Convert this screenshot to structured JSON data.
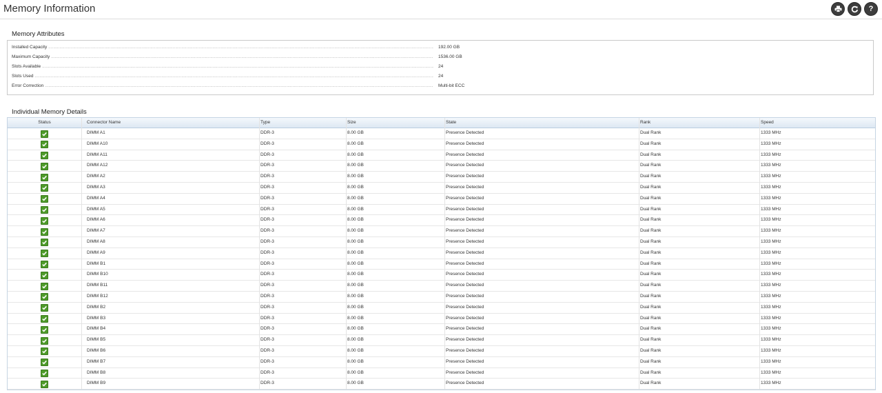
{
  "header": {
    "title": "Memory Information"
  },
  "toolbar": {
    "print_icon": "printer-icon",
    "refresh_icon": "refresh-icon",
    "help_icon": "help-icon",
    "help_glyph": "?"
  },
  "attributes": {
    "title": "Memory Attributes",
    "rows": [
      {
        "label": "Installed Capacity",
        "value": "192.00 GB"
      },
      {
        "label": "Maximum Capacity",
        "value": "1536.00 GB"
      },
      {
        "label": "Slots Available",
        "value": "24"
      },
      {
        "label": "Slots Used",
        "value": "24"
      },
      {
        "label": "Error Correction",
        "value": "Multi-bit ECC"
      }
    ]
  },
  "details": {
    "title": "Individual Memory Details",
    "columns": {
      "status": "Status",
      "name": "Connector Name",
      "type": "Type",
      "size": "Size",
      "state": "State",
      "rank": "Rank",
      "speed": "Speed"
    },
    "status_color": "#4e9a2a",
    "rows": [
      {
        "name": "DIMM A1",
        "type": "DDR-3",
        "size": "8.00 GB",
        "state": "Presence Detected",
        "rank": "Dual Rank",
        "speed": "1333 MHz"
      },
      {
        "name": "DIMM A10",
        "type": "DDR-3",
        "size": "8.00 GB",
        "state": "Presence Detected",
        "rank": "Dual Rank",
        "speed": "1333 MHz"
      },
      {
        "name": "DIMM A11",
        "type": "DDR-3",
        "size": "8.00 GB",
        "state": "Presence Detected",
        "rank": "Dual Rank",
        "speed": "1333 MHz"
      },
      {
        "name": "DIMM A12",
        "type": "DDR-3",
        "size": "8.00 GB",
        "state": "Presence Detected",
        "rank": "Dual Rank",
        "speed": "1333 MHz"
      },
      {
        "name": "DIMM A2",
        "type": "DDR-3",
        "size": "8.00 GB",
        "state": "Presence Detected",
        "rank": "Dual Rank",
        "speed": "1333 MHz"
      },
      {
        "name": "DIMM A3",
        "type": "DDR-3",
        "size": "8.00 GB",
        "state": "Presence Detected",
        "rank": "Dual Rank",
        "speed": "1333 MHz"
      },
      {
        "name": "DIMM A4",
        "type": "DDR-3",
        "size": "8.00 GB",
        "state": "Presence Detected",
        "rank": "Dual Rank",
        "speed": "1333 MHz"
      },
      {
        "name": "DIMM A5",
        "type": "DDR-3",
        "size": "8.00 GB",
        "state": "Presence Detected",
        "rank": "Dual Rank",
        "speed": "1333 MHz"
      },
      {
        "name": "DIMM A6",
        "type": "DDR-3",
        "size": "8.00 GB",
        "state": "Presence Detected",
        "rank": "Dual Rank",
        "speed": "1333 MHz"
      },
      {
        "name": "DIMM A7",
        "type": "DDR-3",
        "size": "8.00 GB",
        "state": "Presence Detected",
        "rank": "Dual Rank",
        "speed": "1333 MHz"
      },
      {
        "name": "DIMM A8",
        "type": "DDR-3",
        "size": "8.00 GB",
        "state": "Presence Detected",
        "rank": "Dual Rank",
        "speed": "1333 MHz"
      },
      {
        "name": "DIMM A9",
        "type": "DDR-3",
        "size": "8.00 GB",
        "state": "Presence Detected",
        "rank": "Dual Rank",
        "speed": "1333 MHz"
      },
      {
        "name": "DIMM B1",
        "type": "DDR-3",
        "size": "8.00 GB",
        "state": "Presence Detected",
        "rank": "Dual Rank",
        "speed": "1333 MHz"
      },
      {
        "name": "DIMM B10",
        "type": "DDR-3",
        "size": "8.00 GB",
        "state": "Presence Detected",
        "rank": "Dual Rank",
        "speed": "1333 MHz"
      },
      {
        "name": "DIMM B11",
        "type": "DDR-3",
        "size": "8.00 GB",
        "state": "Presence Detected",
        "rank": "Dual Rank",
        "speed": "1333 MHz"
      },
      {
        "name": "DIMM B12",
        "type": "DDR-3",
        "size": "8.00 GB",
        "state": "Presence Detected",
        "rank": "Dual Rank",
        "speed": "1333 MHz"
      },
      {
        "name": "DIMM B2",
        "type": "DDR-3",
        "size": "8.00 GB",
        "state": "Presence Detected",
        "rank": "Dual Rank",
        "speed": "1333 MHz"
      },
      {
        "name": "DIMM B3",
        "type": "DDR-3",
        "size": "8.00 GB",
        "state": "Presence Detected",
        "rank": "Dual Rank",
        "speed": "1333 MHz"
      },
      {
        "name": "DIMM B4",
        "type": "DDR-3",
        "size": "8.00 GB",
        "state": "Presence Detected",
        "rank": "Dual Rank",
        "speed": "1333 MHz"
      },
      {
        "name": "DIMM B5",
        "type": "DDR-3",
        "size": "8.00 GB",
        "state": "Presence Detected",
        "rank": "Dual Rank",
        "speed": "1333 MHz"
      },
      {
        "name": "DIMM B6",
        "type": "DDR-3",
        "size": "8.00 GB",
        "state": "Presence Detected",
        "rank": "Dual Rank",
        "speed": "1333 MHz"
      },
      {
        "name": "DIMM B7",
        "type": "DDR-3",
        "size": "8.00 GB",
        "state": "Presence Detected",
        "rank": "Dual Rank",
        "speed": "1333 MHz"
      },
      {
        "name": "DIMM B8",
        "type": "DDR-3",
        "size": "8.00 GB",
        "state": "Presence Detected",
        "rank": "Dual Rank",
        "speed": "1333 MHz"
      },
      {
        "name": "DIMM B9",
        "type": "DDR-3",
        "size": "8.00 GB",
        "state": "Presence Detected",
        "rank": "Dual Rank",
        "speed": "1333 MHz"
      }
    ]
  }
}
